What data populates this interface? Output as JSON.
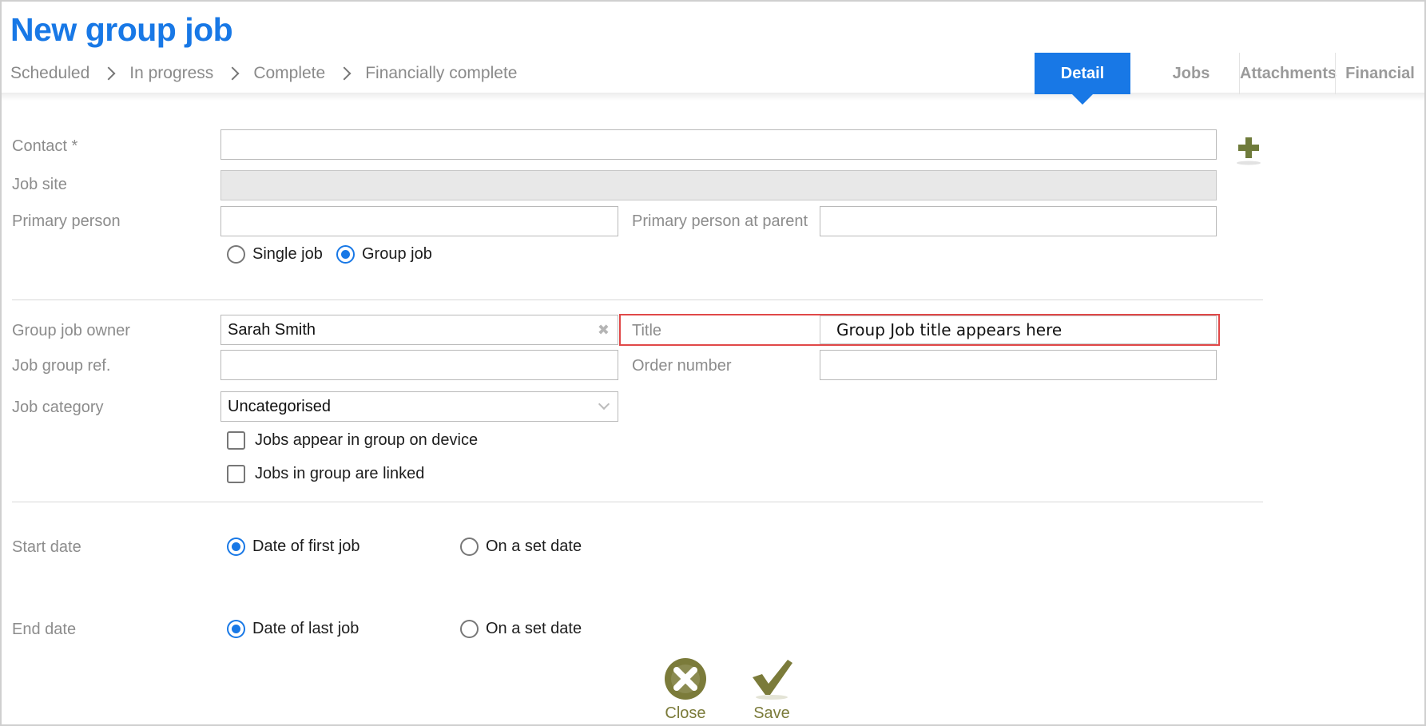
{
  "page": {
    "title": "New group job"
  },
  "breadcrumb": [
    "Scheduled",
    "In progress",
    "Complete",
    "Financially complete"
  ],
  "tabs": [
    {
      "label": "Detail",
      "active": true
    },
    {
      "label": "Jobs",
      "active": false
    },
    {
      "label": "Attachments",
      "active": false
    },
    {
      "label": "Financial",
      "active": false
    }
  ],
  "form": {
    "contact": {
      "label": "Contact *",
      "value": ""
    },
    "job_site": {
      "label": "Job site",
      "value": ""
    },
    "primary_person": {
      "label": "Primary person",
      "value": ""
    },
    "primary_person_parent": {
      "label": "Primary person at parent",
      "value": ""
    },
    "job_type": {
      "options": [
        "Single job",
        "Group job"
      ],
      "selected": "Group job"
    },
    "group_job_owner": {
      "label": "Group job owner",
      "value": "Sarah Smith"
    },
    "title": {
      "label": "Title",
      "value": "Group Job title appears here"
    },
    "job_group_ref": {
      "label": "Job group ref.",
      "value": ""
    },
    "order_number": {
      "label": "Order number",
      "value": ""
    },
    "job_category": {
      "label": "Job category",
      "value": "Uncategorised"
    },
    "checkboxes": [
      {
        "label": "Jobs appear in group on device",
        "checked": false
      },
      {
        "label": "Jobs in group are linked",
        "checked": false
      }
    ],
    "start_date": {
      "label": "Start date",
      "options": [
        "Date of first job",
        "On a set date"
      ],
      "selected": "Date of first job"
    },
    "end_date": {
      "label": "End date",
      "options": [
        "Date of last job",
        "On a set date"
      ],
      "selected": "Date of last job"
    }
  },
  "actions": {
    "close_label": "Close",
    "save_label": "Save"
  },
  "colors": {
    "accent": "#1878e6",
    "highlight_border": "#e04848",
    "action_olive": "#7b7b3a"
  },
  "icons": {
    "add_contact": "plus-icon",
    "clear_owner": "close-small-icon",
    "category_dropdown": "chevron-down-icon",
    "close_action": "close-circle-icon",
    "save_action": "checkmark-icon"
  }
}
